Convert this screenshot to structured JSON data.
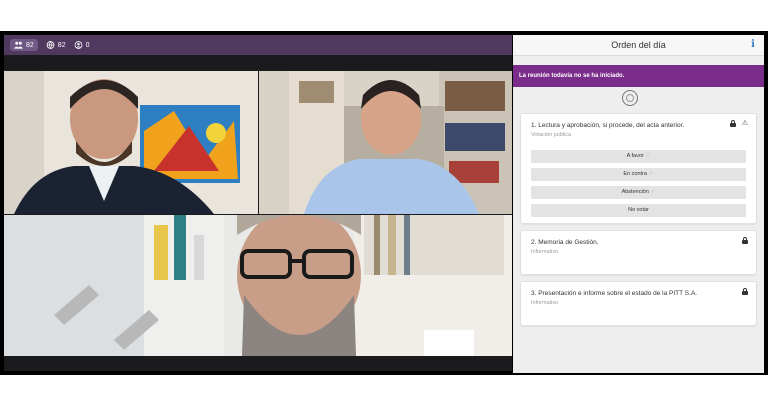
{
  "topbar": {
    "participants": "82",
    "connected": "82",
    "guests": "0"
  },
  "agenda": {
    "title": "Orden del día",
    "status": "La reunión todavía no se ha iniciado.",
    "items": [
      {
        "title": "1. Lectura y aprobación, si procede, del acta anterior.",
        "subtitle": "Votación pública",
        "options": [
          "A favor",
          "En contra",
          "Abstención",
          "No votar"
        ]
      },
      {
        "title": "2. Memoria de Gestión.",
        "subtitle": "Informativo"
      },
      {
        "title": "3. Presentación e informe sobre el estado de la PITT S.A.",
        "subtitle": "Informativo"
      }
    ]
  },
  "colors": {
    "topbar": "#50395f",
    "status_bar": "#7b2d8b",
    "info_icon": "#3d7fc4"
  },
  "icons": [
    "people-icon",
    "globe-icon",
    "guest-icon",
    "info-icon",
    "lock-icon",
    "warning-icon",
    "check-icon"
  ]
}
